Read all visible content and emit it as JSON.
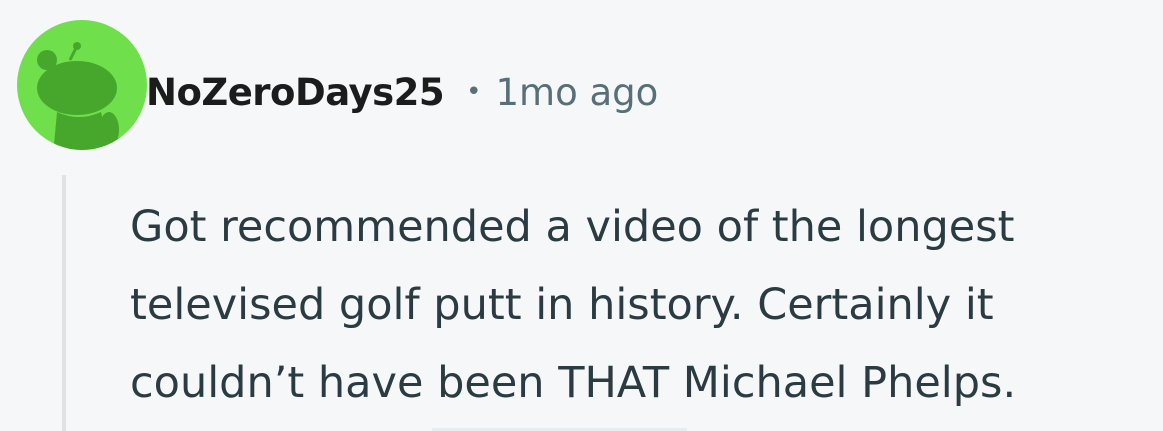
{
  "comment": {
    "author": "NoZeroDays25",
    "separator": "•",
    "timestamp": "1mo ago",
    "body_lines": [
      "Got recommended a video of the longest",
      "televised golf putt in history. Certainly it",
      "couldn’t have been THAT Michael Phelps."
    ],
    "avatar": {
      "icon": "snoo-avatar-icon",
      "background_color": "#6fe04c",
      "figure_color": "#46a72c"
    }
  },
  "colors": {
    "page_background": "#f6f7f8",
    "username": "#1c1c1c",
    "meta": "#576f76",
    "body_text": "#2a3c42",
    "thread_line": "#dfe3e6"
  }
}
